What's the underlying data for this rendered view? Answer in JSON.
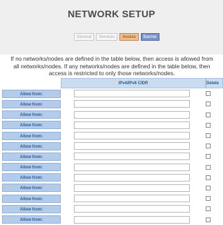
{
  "page": {
    "title": "NETWORK SETUP"
  },
  "tabs": [
    {
      "label": "General",
      "state": "inactive"
    },
    {
      "label": "Services",
      "state": "inactive"
    },
    {
      "label": "Access",
      "state": "active"
    },
    {
      "label": "Banner",
      "state": "highlighted"
    }
  ],
  "info_text": "If no networks/nodes are defined in the table below, then access is allowed from all networks/nodes. If any networks/nodes are defined in the table below, then access is restricted to only those networks/nodes.",
  "table": {
    "headers": {
      "cidr": "IPv4/IPv6 CIDR",
      "delete": "Delete"
    },
    "rows": [
      {
        "label": "Allow from:",
        "value": "",
        "checked": false
      },
      {
        "label": "Allow from:",
        "value": "",
        "checked": false
      },
      {
        "label": "Allow from:",
        "value": "",
        "checked": false
      },
      {
        "label": "Allow from:",
        "value": "",
        "checked": false
      },
      {
        "label": "Allow from:",
        "value": "",
        "checked": false
      },
      {
        "label": "Allow from:",
        "value": "",
        "checked": false
      },
      {
        "label": "Allow from:",
        "value": "",
        "checked": false
      },
      {
        "label": "Allow from:",
        "value": "",
        "checked": false
      },
      {
        "label": "Allow from:",
        "value": "",
        "checked": false
      },
      {
        "label": "Allow from:",
        "value": "",
        "checked": false
      },
      {
        "label": "Allow from:",
        "value": "",
        "checked": false
      },
      {
        "label": "Allow from:",
        "value": "",
        "checked": false
      },
      {
        "label": "Allow from:",
        "value": "",
        "checked": false
      }
    ]
  },
  "colors": {
    "header_bg": "#efefef",
    "active_tab": "#f0c08c",
    "highlight_tab": "#7a94c8",
    "allow_label_bg": "#b3cceb",
    "table_header_bg": "#c9dcf0"
  }
}
